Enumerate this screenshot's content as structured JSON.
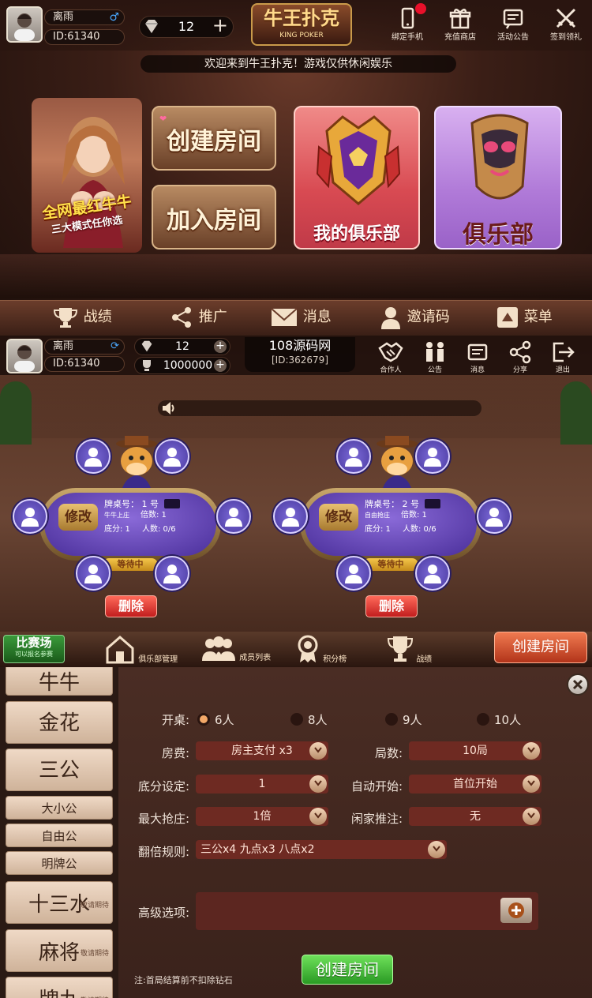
{
  "lobby": {
    "user": {
      "name": "离雨",
      "id": "ID:61340"
    },
    "gems": "12",
    "logo": {
      "title": "牛王扑克",
      "subtitle": "KING POKER"
    },
    "top_icons": [
      {
        "label": "绑定手机",
        "icon": "phone-icon"
      },
      {
        "label": "充值商店",
        "icon": "gift-icon"
      },
      {
        "label": "活动公告",
        "icon": "announcement-icon"
      },
      {
        "label": "签到领礼",
        "icon": "swords-icon"
      }
    ],
    "marquee": "欢迎来到牛王扑克！游戏仅供休闲娱乐",
    "promo": {
      "line1": "全网最红牛牛",
      "line2": "三大模式任你选"
    },
    "create_room": "创建房间",
    "join_room": "加入房间",
    "my_club": "我的俱乐部",
    "club": "俱乐部",
    "nav": [
      {
        "label": "战绩",
        "icon": "trophy-icon"
      },
      {
        "label": "推广",
        "icon": "share-icon"
      },
      {
        "label": "消息",
        "icon": "mail-icon"
      },
      {
        "label": "邀请码",
        "icon": "user-icon"
      },
      {
        "label": "菜单",
        "icon": "menu-icon"
      }
    ]
  },
  "club": {
    "user": {
      "name": "离雨",
      "id": "ID:61340"
    },
    "gems": "12",
    "gold": "1000000",
    "title": "108源码网",
    "club_id": "[ID:362679]",
    "top_icons": [
      {
        "label": "合作人",
        "icon": "handshake-icon"
      },
      {
        "label": "公告",
        "icon": "people-icon"
      },
      {
        "label": "消息",
        "icon": "message-icon"
      },
      {
        "label": "分享",
        "icon": "share-icon"
      },
      {
        "label": "退出",
        "icon": "exit-icon"
      }
    ],
    "tables": [
      {
        "edit": "修改",
        "number": "牌桌号： 1 号",
        "mode": "牛牛上庄",
        "multiplier": "倍数: 1",
        "base": "底分: 1",
        "players": "人数: 0/6",
        "status": "等待中",
        "delete": "删除"
      },
      {
        "edit": "修改",
        "number": "牌桌号： 2 号",
        "mode": "自由抢庄",
        "multiplier": "倍数: 1",
        "base": "底分: 1",
        "players": "人数: 0/6",
        "status": "等待中",
        "delete": "删除"
      }
    ],
    "match": {
      "title": "比赛场",
      "sub": "可以报名参赛"
    },
    "bottom": [
      {
        "label": "俱乐部管理",
        "icon": "house-icon"
      },
      {
        "label": "成员列表",
        "icon": "members-icon"
      },
      {
        "label": "积分榜",
        "icon": "medal-icon"
      },
      {
        "label": "战绩",
        "icon": "cup-icon"
      }
    ],
    "create_room": "创建房间"
  },
  "create": {
    "games": [
      {
        "label": "牛牛",
        "soon": ""
      },
      {
        "label": "金花",
        "soon": ""
      },
      {
        "label": "三公",
        "soon": ""
      },
      {
        "label": "大小公",
        "soon": ""
      },
      {
        "label": "自由公",
        "soon": ""
      },
      {
        "label": "明牌公",
        "soon": ""
      },
      {
        "label": "十三水",
        "soon": "敬请期待"
      },
      {
        "label": "麻将",
        "soon": "敬请期待"
      },
      {
        "label": "牌九",
        "soon": "敬请期待"
      }
    ],
    "seats_label": "开桌:",
    "seat_options": [
      "6人",
      "8人",
      "9人",
      "10人"
    ],
    "fee_label": "房费:",
    "fee_value": "房主支付 x3",
    "rounds_label": "局数:",
    "rounds_value": "10局",
    "base_label": "底分设定:",
    "base_value": "1",
    "autostart_label": "自动开始:",
    "autostart_value": "首位开始",
    "maxbid_label": "最大抢庄:",
    "maxbid_value": "1倍",
    "push_label": "闲家推注:",
    "push_value": "无",
    "rule_label": "翻倍规则:",
    "rule_value": "三公x4  九点x3  八点x2",
    "advanced_label": "高级选项:",
    "note": "注:首局结算前不扣除钻石",
    "create_button": "创建房间"
  }
}
